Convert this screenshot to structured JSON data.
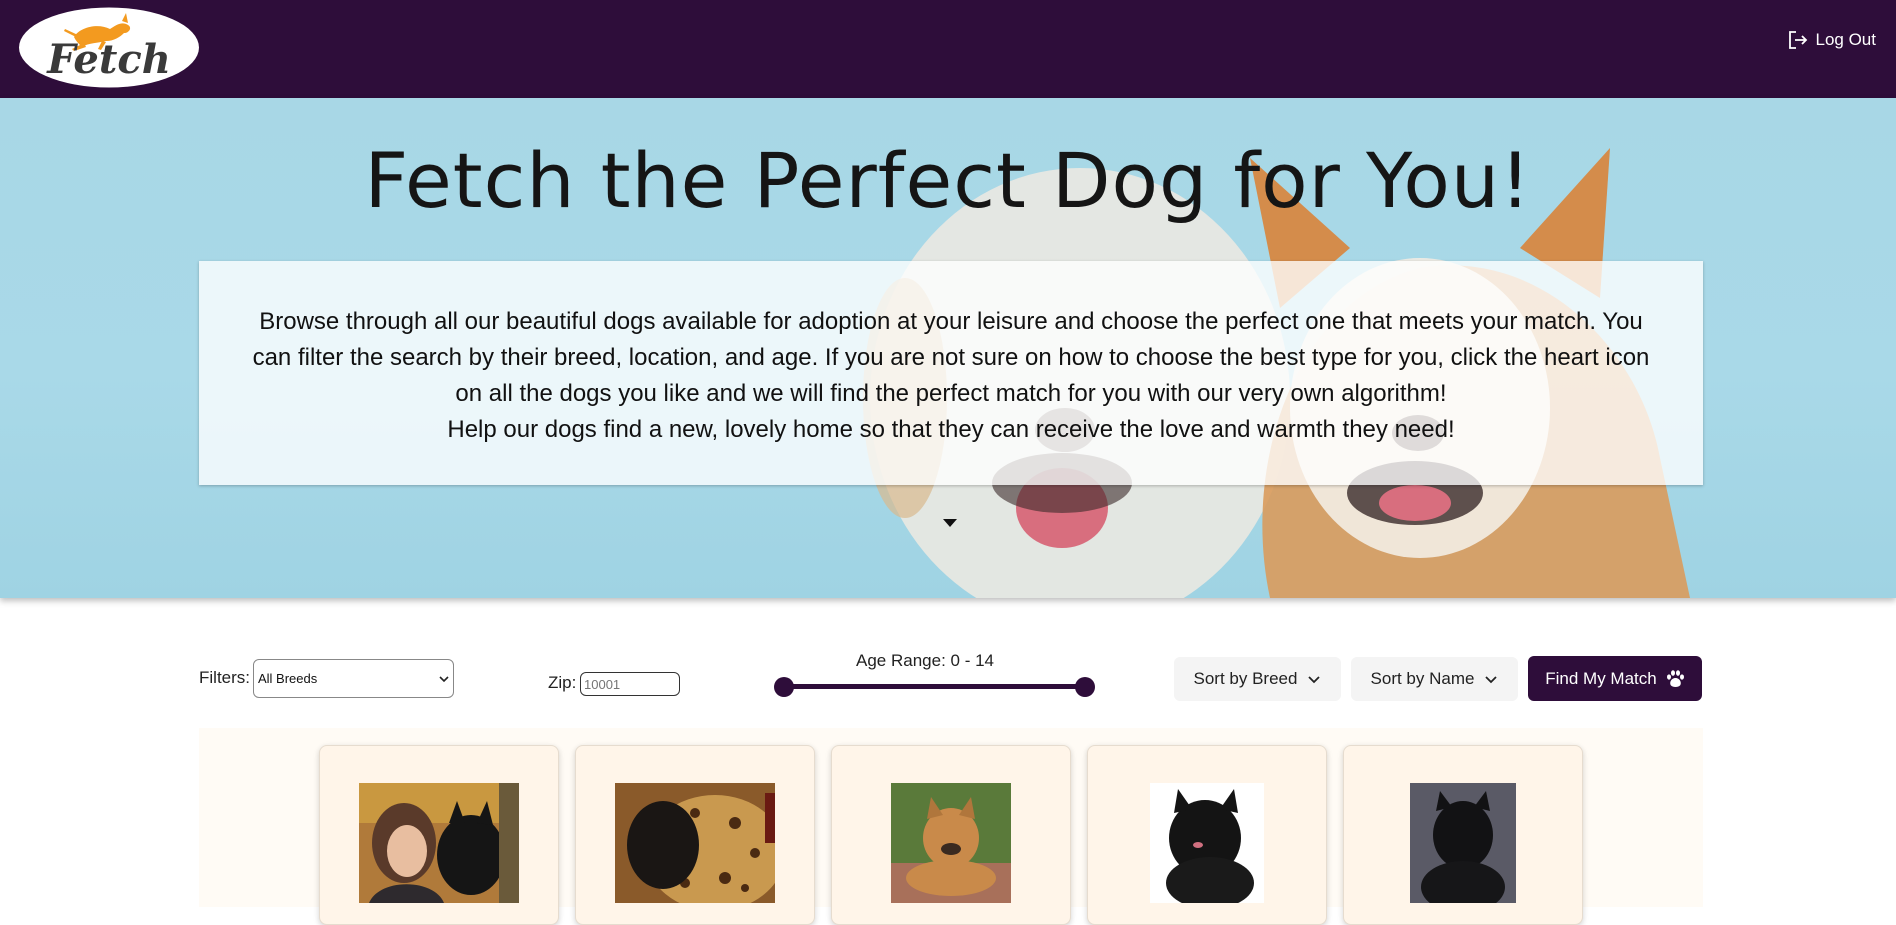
{
  "header": {
    "logo_text": "Fetch",
    "logout_label": "Log Out"
  },
  "hero": {
    "title": "Fetch the Perfect Dog for You!",
    "paragraph_1": "Browse through all our beautiful dogs available for adoption at your leisure and choose the perfect one that meets your match. You can filter the search by their breed, location, and age. If you are not sure on how to choose the best type for you, click the heart icon on all the dogs you like and we will find the perfect match for you with our very own algorithm!",
    "paragraph_2": "Help our dogs find a new, lovely home so that they can receive the love and warmth they need!"
  },
  "filters": {
    "label": "Filters:",
    "breed_selected": "All Breeds",
    "zip_label": "Zip:",
    "zip_placeholder": "10001",
    "age_label": "Age Range: 0 - 14",
    "age_min": 0,
    "age_max": 14,
    "sort_breed_label": "Sort by Breed",
    "sort_name_label": "Sort by Name",
    "match_label": "Find My Match"
  },
  "dogs": [
    {
      "photo": "woman-with-black-dog-photo"
    },
    {
      "photo": "black-dog-in-leopard-bed-photo"
    },
    {
      "photo": "tan-dog-lying-on-bricks-photo"
    },
    {
      "photo": "black-scruffy-dog-photo"
    },
    {
      "photo": "black-dog-portrait-photo"
    }
  ],
  "colors": {
    "brand_purple": "#2e0d3a",
    "hero_sky": "#a8d7e6",
    "card_bg": "#fff5e9"
  }
}
